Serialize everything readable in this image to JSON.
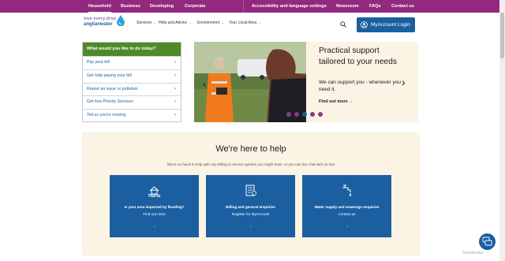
{
  "topbar": {
    "household": "Household",
    "business": "Business",
    "developing": "Developing",
    "corporate": "Corporate",
    "accessibility": "Accessibility and language settings",
    "newsroom": "Newsroom",
    "faqs": "FAQs",
    "contact": "Contact us"
  },
  "logo": {
    "line1": "love every drop",
    "line2": "anglianwater"
  },
  "nav": {
    "services": "Services",
    "help": "Help and Advice",
    "environment": "Environment",
    "area": "Your Local Area"
  },
  "account": {
    "label": "MyAccount Login"
  },
  "quick_links": {
    "heading": "What would you like to do today?",
    "items": [
      "Pay your bill",
      "Get help paying your bill",
      "Report an issue or pollution",
      "Get free Priority Services",
      "Tell us you're moving"
    ]
  },
  "hero": {
    "title": "Practical support tailored to your needs",
    "text": "We can support you - whenever you need it.",
    "link": "Find out more →"
  },
  "carousel": {
    "dots": [
      "#8a3a8a",
      "#8a3a8a",
      "#1b5fa0",
      "#8a3a8a",
      "#8a3a8a"
    ],
    "active": 2
  },
  "help": {
    "title": "We're here to help",
    "subtitle": "We're on hand to help with any billing or service queries you might have, or you can live chat with us too!",
    "cards": [
      {
        "title": "Is your area impacted by flooding?",
        "link": "Find out more",
        "arrow": "→",
        "icon": "flood-icon"
      },
      {
        "title": "Billing and general enquiries",
        "link": "Register for MyAccount",
        "arrow": "→",
        "icon": "bill-icon"
      },
      {
        "title": "Water supply and sewerage enquiries",
        "link": "Contact us",
        "arrow": "→",
        "icon": "tap-icon"
      }
    ]
  },
  "watermark": "ScanMaster",
  "colors": {
    "brand_purple": "#93297f",
    "brand_blue": "#1b5fa0",
    "green": "#4e8a2a",
    "cream": "#fbf3e3"
  }
}
